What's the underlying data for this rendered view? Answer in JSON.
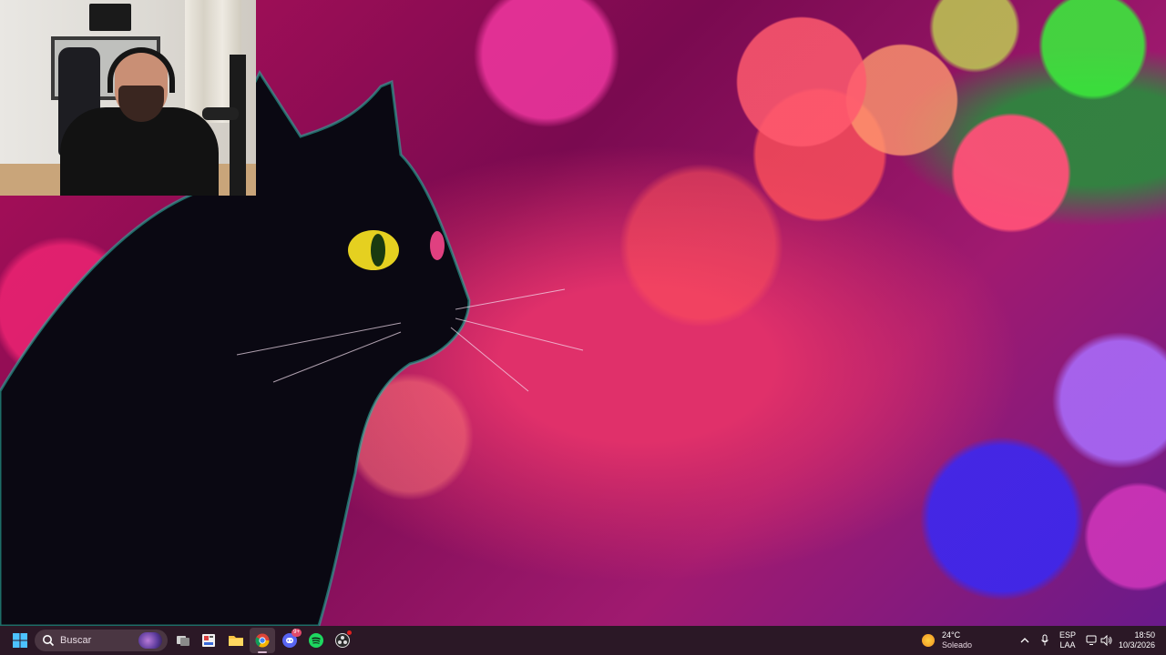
{
  "taskbar": {
    "search_placeholder": "Buscar",
    "weather": {
      "temp": "24°C",
      "condition": "Soleado"
    },
    "language": {
      "line1": "ESP",
      "line2": "LAA"
    },
    "clock": {
      "time": "18:50",
      "date": "10/3/2026"
    },
    "discord_badge": "9+",
    "apps": [
      "start-icon",
      "task-view-icon",
      "widgets-icon",
      "file-explorer-icon",
      "chrome-icon",
      "discord-icon",
      "spotify-icon",
      "obs-icon"
    ]
  },
  "colors": {
    "taskbar_bg": "#2b1826",
    "search_bg": "#4a3642"
  }
}
